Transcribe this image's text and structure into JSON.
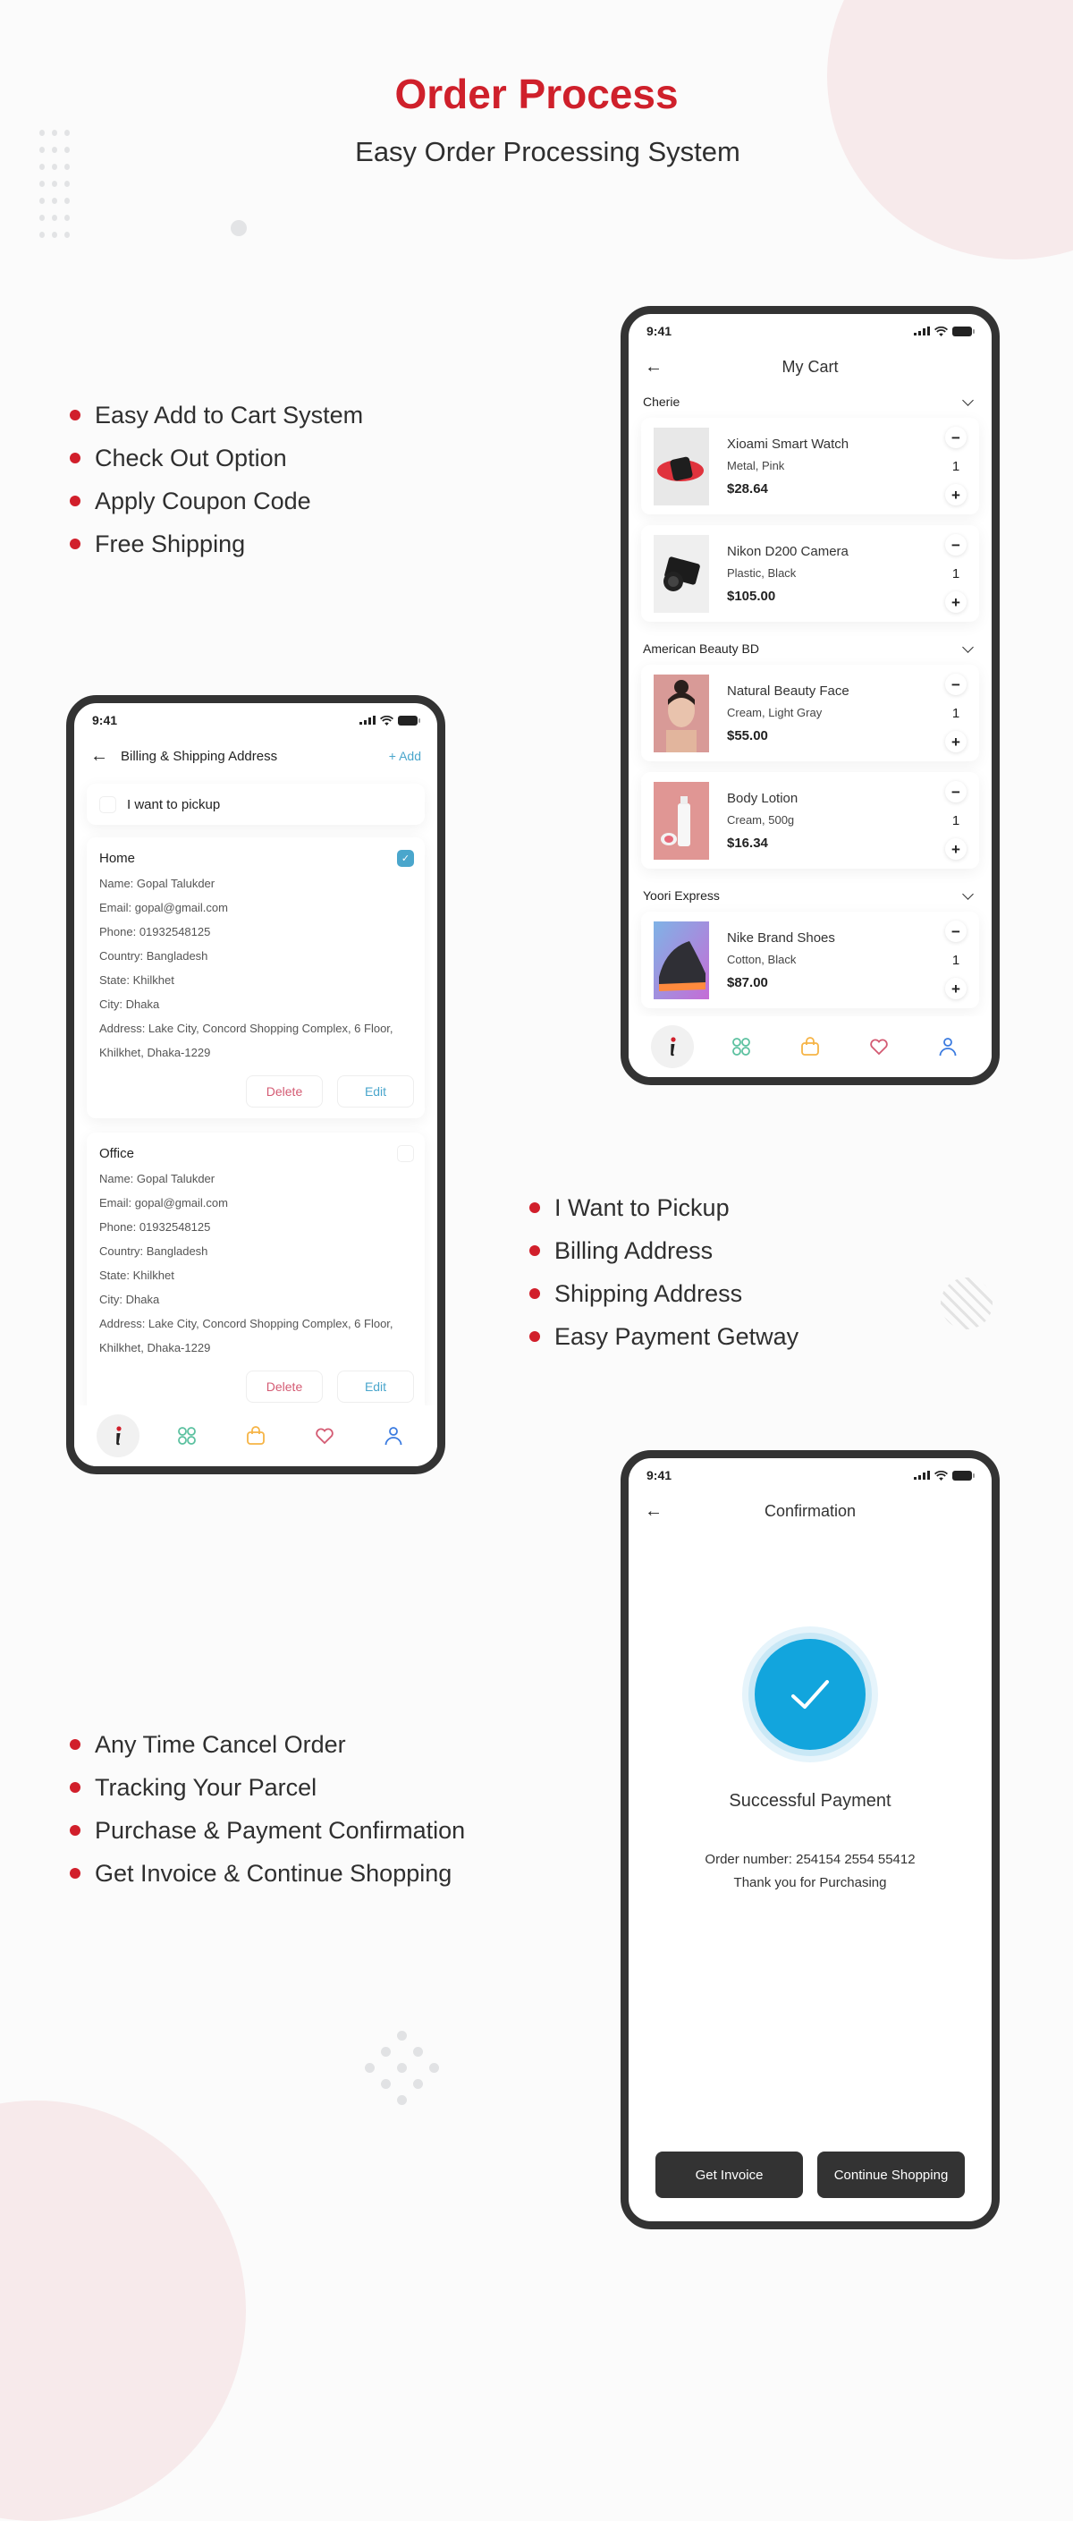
{
  "header": {
    "title": "Order Process",
    "subtitle": "Easy Order Processing System"
  },
  "colors": {
    "accent_red": "#cf202b",
    "checkbox_blue": "#4aa6cc",
    "success_blue": "#12a5dd",
    "dark_button": "#333333",
    "nav_home": "#d11f2b",
    "nav_categories": "#5cc1a0",
    "nav_bag": "#f6b446",
    "nav_wishlist": "#d45b73",
    "nav_profile": "#3b7be0"
  },
  "features_cart": [
    "Easy Add to Cart System",
    "Check Out Option",
    "Apply Coupon Code",
    "Free Shipping"
  ],
  "features_address": [
    "I Want to Pickup",
    "Billing Address",
    "Shipping Address",
    "Easy Payment Getway"
  ],
  "features_confirm": [
    "Any Time Cancel Order",
    "Tracking Your Parcel",
    "Purchase & Payment Confirmation",
    "Get Invoice & Continue Shopping"
  ],
  "status_time": "9:41",
  "cart_screen": {
    "title": "My Cart",
    "stores": [
      {
        "name": "Cherie",
        "items": [
          {
            "name": "Xioami Smart Watch",
            "variant": "Metal, Pink",
            "price": "$28.64",
            "qty": "1",
            "image": "smart-watch"
          },
          {
            "name": "Nikon D200 Camera",
            "variant": "Plastic, Black",
            "price": "$105.00",
            "qty": "1",
            "image": "camera"
          }
        ]
      },
      {
        "name": "American Beauty BD",
        "items": [
          {
            "name": "Natural Beauty Face",
            "variant": "Cream, Light Gray",
            "price": "$55.00",
            "qty": "1",
            "image": "face-portrait"
          },
          {
            "name": "Body Lotion",
            "variant": "Cream, 500g",
            "price": "$16.34",
            "qty": "1",
            "image": "lotion-bottle"
          }
        ]
      },
      {
        "name": "Yoori Express",
        "items": [
          {
            "name": "Nike Brand Shoes",
            "variant": "Cotton, Black",
            "price": "$87.00",
            "qty": "1",
            "image": "sneakers"
          }
        ]
      }
    ]
  },
  "address_screen": {
    "title": "Billing & Shipping Address",
    "add_label": "+ Add",
    "pickup_label": "I want to pickup",
    "pickup_checked": false,
    "addresses": [
      {
        "title": "Home",
        "selected": true,
        "lines": [
          "Name: Gopal Talukder",
          "Email: gopal@gmail.com",
          "Phone: 01932548125",
          "Country: Bangladesh",
          "State: Khilkhet",
          "City: Dhaka",
          "Address: Lake City, Concord Shopping Complex, 6 Floor, Khilkhet, Dhaka-1229"
        ],
        "delete_label": "Delete",
        "edit_label": "Edit"
      },
      {
        "title": "Office",
        "selected": false,
        "lines": [
          "Name: Gopal Talukder",
          "Email: gopal@gmail.com",
          "Phone: 01932548125",
          "Country: Bangladesh",
          "State: Khilkhet",
          "City: Dhaka",
          "Address: Lake City, Concord Shopping Complex, 6 Floor, Khilkhet, Dhaka-1229"
        ],
        "delete_label": "Delete",
        "edit_label": "Edit"
      }
    ]
  },
  "confirm_screen": {
    "title": "Confirmation",
    "success_title": "Successful Payment",
    "order_number": "Order number: 254154 2554 55412",
    "thanks": "Thank you for Purchasing",
    "invoice_label": "Get Invoice",
    "continue_label": "Continue Shopping"
  },
  "bottom_nav": [
    {
      "name": "home",
      "icon": "info-logo-icon",
      "active": true
    },
    {
      "name": "categories",
      "icon": "grid-icon",
      "active": false
    },
    {
      "name": "bag",
      "icon": "shopping-bag-icon",
      "active": false
    },
    {
      "name": "wishlist",
      "icon": "heart-icon",
      "active": false
    },
    {
      "name": "profile",
      "icon": "user-icon",
      "active": false
    }
  ]
}
